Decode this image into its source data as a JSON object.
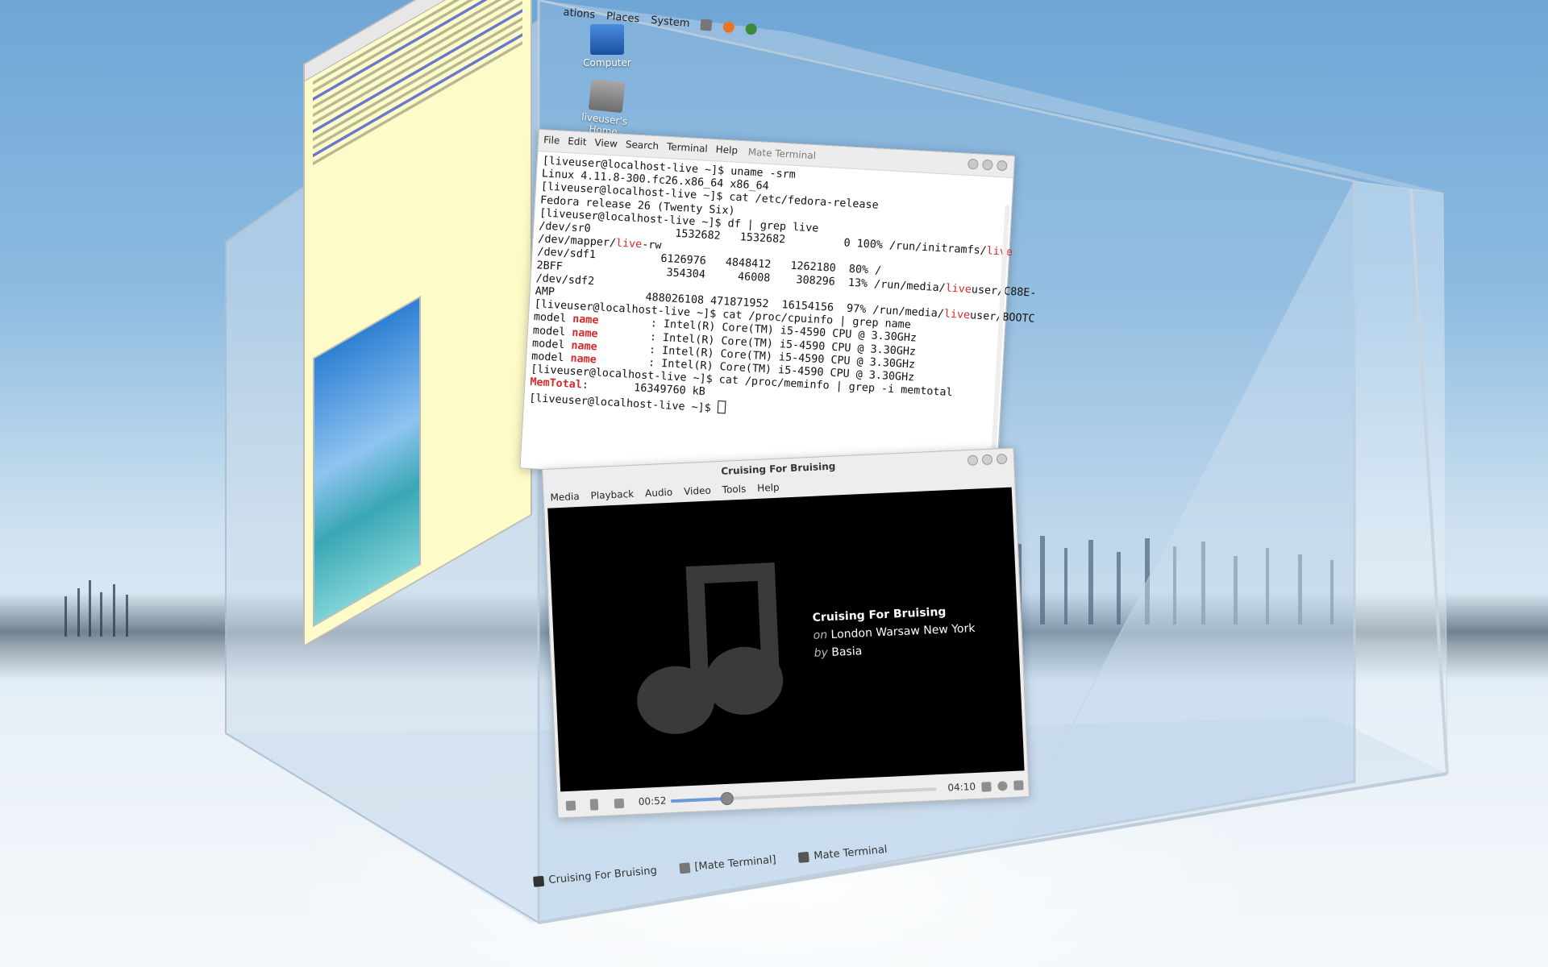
{
  "top_panel": {
    "menus": [
      "ations",
      "Places",
      "System"
    ]
  },
  "desktop_icons": [
    {
      "label": "Computer",
      "icon": "computer-icon"
    },
    {
      "label": "liveuser's Home",
      "icon": "home-folder-icon"
    }
  ],
  "terminal": {
    "title": "Mate Terminal",
    "menus": [
      "File",
      "Edit",
      "View",
      "Search",
      "Terminal",
      "Help"
    ],
    "lines": [
      "[liveuser@localhost-live ~]$ uname -srm",
      "Linux 4.11.8-300.fc26.x86_64 x86_64",
      "[liveuser@localhost-live ~]$ cat /etc/fedora-release",
      "Fedora release 26 (Twenty Six)",
      "[liveuser@localhost-live ~]$ df | grep live",
      "/dev/sr0             1532682   1532682         0 100% /run/initramfs/",
      "/dev/mapper/",
      "/dev/sdf1          6126976   4848412   1262180  80% /",
      "2BFF                354304     46008    308296  13% /run/media/",
      "/dev/sdf2",
      "AMP              488026108 471871952  16154156  97% /run/media/",
      "[liveuser@localhost-live ~]$ cat /proc/cpuinfo | grep name",
      "model ",
      "[liveuser@localhost-live ~]$ cat /proc/meminfo | grep -i memtotal",
      "[liveuser@localhost-live ~]$ "
    ],
    "hl_live": "live",
    "hl_rw": "-rw",
    "user_suffix_1": "user/C88E-",
    "user_suffix_2": "user/BOOTC",
    "hl_name": "name",
    "cpu_rest": "        : Intel(R) Core(TM) i5-4590 CPU @ 3.30GHz",
    "mem_label": "MemTotal",
    "mem_value": ":       16349760 kB"
  },
  "player": {
    "title": "Cruising For Bruising",
    "menus": [
      "Media",
      "Playback",
      "Audio",
      "Video",
      "Tools",
      "Help"
    ],
    "track_title": "Cruising For Bruising",
    "album_prefix": "on",
    "album": "London Warsaw New York",
    "artist_prefix": "by",
    "artist": "Basia",
    "elapsed": "00:52",
    "duration": "04:10",
    "progress_fraction": 0.21
  },
  "taskbar": {
    "items": [
      "Cruising For Bruising",
      "[Mate Terminal]",
      "Mate Terminal"
    ]
  }
}
